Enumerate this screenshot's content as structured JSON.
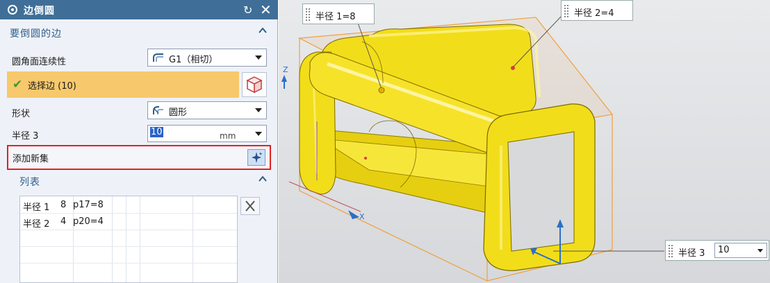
{
  "dialog": {
    "title": "边倒圆",
    "icons": {
      "app": "gear-icon",
      "reset": "reset-icon",
      "close": "close-icon"
    }
  },
  "edges_section": {
    "title": "要倒圆的边",
    "continuity_label": "圆角面连续性",
    "continuity_value": "G1（相切）",
    "select_edge_label": "选择边 (10)",
    "shape_label": "形状",
    "shape_value": "圆形",
    "radius_label": "半径 3",
    "radius_value": "10",
    "radius_unit": "mm",
    "add_set_label": "添加新集"
  },
  "list_section": {
    "title": "列表",
    "rows": [
      {
        "name": "半径 1",
        "value": "8",
        "expr": "p17=8"
      },
      {
        "name": "半径 2",
        "value": "4",
        "expr": "p20=4"
      }
    ]
  },
  "viewport": {
    "callout1": "半径 1=8",
    "callout2": "半径 2=4",
    "callout3_label": "半径 3",
    "callout3_value": "10",
    "axis_x": "X",
    "axis_z": "Z",
    "colors": {
      "body": "#f2dd1a",
      "body_shade": "#d9c200",
      "box": "#f0a040",
      "axis_blue": "#2a6fc9"
    }
  }
}
